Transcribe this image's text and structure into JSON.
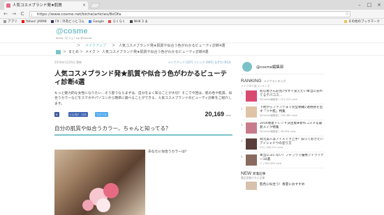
{
  "browser": {
    "tab_title": "人気コスメブランド発★肌質",
    "tab_close": "×",
    "url": "https://www.cosme.net/biche/articles/8xOfa",
    "bookmarks": [
      "アプリ",
      "Yahoo! JAPAN",
      "FX｜外為どっとコム",
      "Google",
      "らくらく",
      "NHK 3 ま"
    ],
    "other_bookmarks": "その他のブックマーク",
    "win_minimize": "–",
    "win_maximize": "□",
    "win_close": "×",
    "back": "←",
    "forward": "→",
    "reload": "C",
    "lock": "i",
    "star": "☆"
  },
  "site": {
    "logo": "@cosme",
    "logo_sub": "biche（ビシェ）by @cosme",
    "nav_sep": "＞",
    "nav_category": "メイクアップ",
    "nav_current": "人気コスメブランド発★肌質や似合う色がわかるビューティ診断4選",
    "crumb_home": "まとめ",
    "crumb_make": "メイク",
    "crumb_current": "人気コスメブランド発★肌質や似合う色がわかるビューティ診断4選"
  },
  "article": {
    "date": "2016年1月29日 更新",
    "tags": "メイクアップ (327)  トレンド (695)  なぞ力 (914)",
    "title": "人気コスメブランド発★肌質や似合う色がわかるビューティ診断4選",
    "lead": "もっと魅力的な女性になりたい…そう思うならまずは、自分をよく知ることが大切！そこで今回は、肌の色や肌質、似合うカラーなどをスマホやパソコンから簡単に調べることができる、人気コスメブランドのビューティ診断をご紹介します。",
    "share_fb": "B",
    "share_like": "いいね！ 125",
    "share_x": "ツイート",
    "views": "20,169",
    "views_unit": "view",
    "section_title": "自分の肌質や似合うカラー、ちゃんと知ってる？",
    "side_question": "あなたに似合うカラーは？"
  },
  "sidebar": {
    "editor_name": "@cosme編集部",
    "ranking_title": "RANKING",
    "ranking_label": "メイクランキング",
    "ranking_sub": "メイクの人気ランキング",
    "items": [
      {
        "rank": "1",
        "title": "初心者さん必見♪今すぐ覚えたい本当に売れてるデパコス…",
        "meta": "@cosme編集部 | 221,319 view"
      },
      {
        "rank": "2",
        "title": "下地からファンデまで完全網羅♪透明感を出す「ツヤ肌」特集",
        "meta": "@cosme編集部 | 258,460 view"
      },
      {
        "rank": "3",
        "title": "2016春夏トレンド決定版★新作コスメ＆最新メイク特集",
        "meta": "@cosme編集部 | 36,828 view"
      },
      {
        "rank": "4",
        "title": "目元美人はアイメイク上手！知っておきたいアイシャドウの塗り方",
        "meta": "Chi | 580,521 view"
      },
      {
        "rank": "5",
        "title": "本当にヨレない！プチプラで優秀アイライナー10選",
        "meta": "ク | 584,383 view"
      }
    ],
    "new_title": "NEW",
    "new_label": "新着記事",
    "new_sub": "最近投稿された記事",
    "new_items": [
      {
        "title": "肌色に似合う！春夏におすすめ"
      }
    ]
  },
  "colors": {
    "accent": "#7ac2c7",
    "fb": "#3b5998",
    "tw": "#55acee"
  }
}
